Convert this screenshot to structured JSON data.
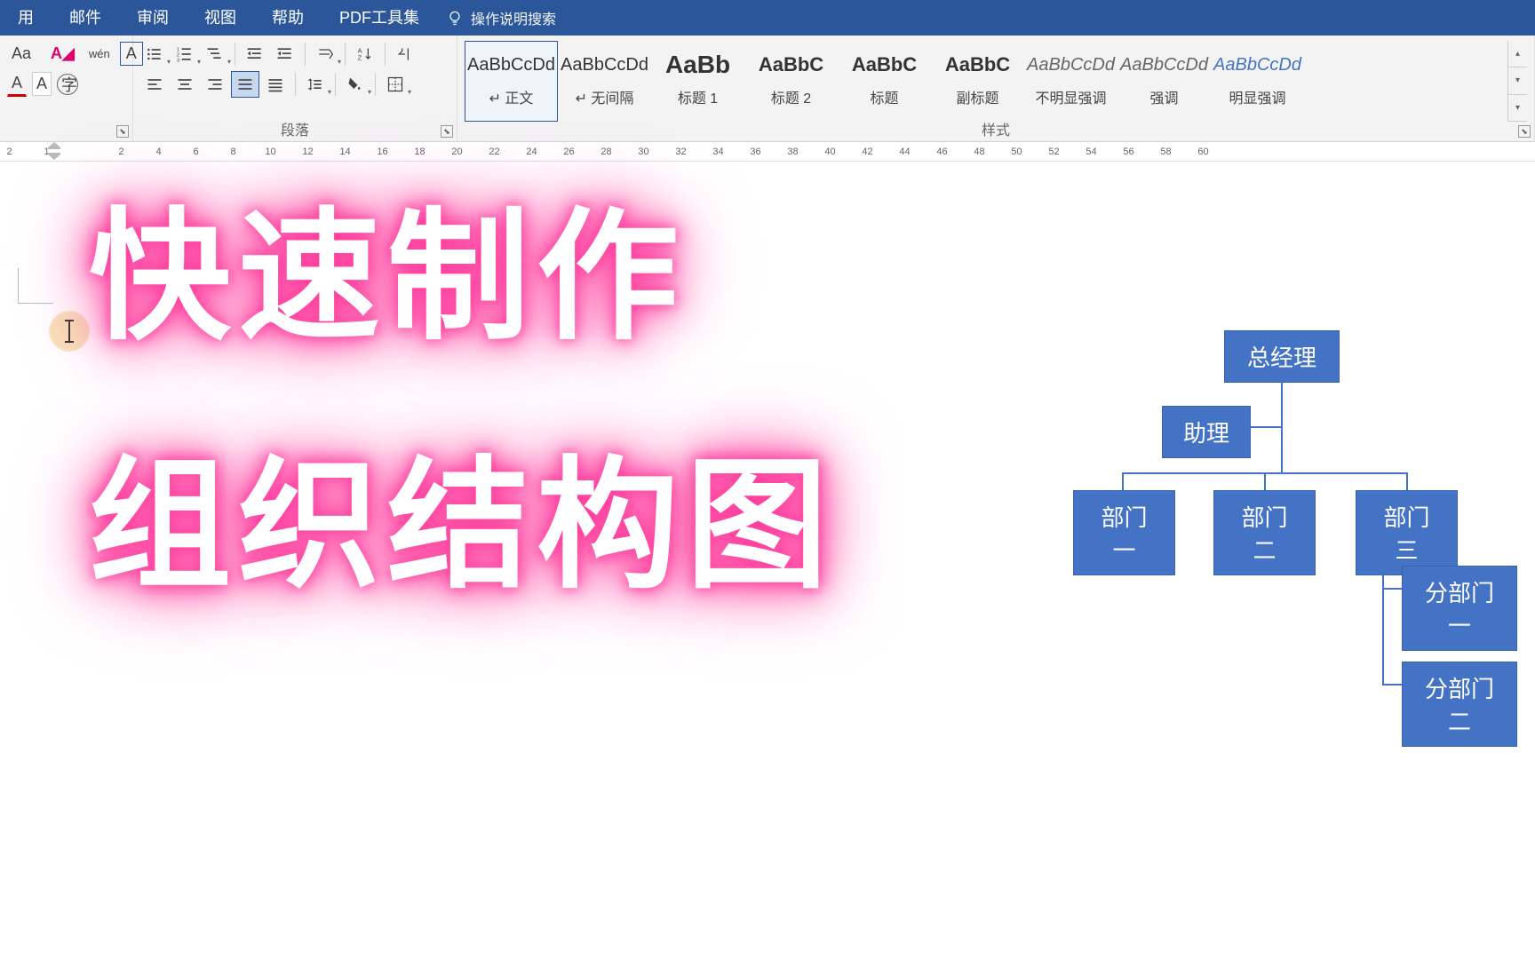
{
  "menu": {
    "tabs": [
      "用",
      "邮件",
      "审阅",
      "视图",
      "帮助",
      "PDF工具集"
    ],
    "search_placeholder": "操作说明搜索"
  },
  "ribbon": {
    "font": {
      "aa": "Aa",
      "wen": "wén",
      "char_box": "A",
      "color_a": "A",
      "circled": "字"
    },
    "paragraph": {
      "label": "段落"
    },
    "styles": {
      "label": "样式",
      "items": [
        {
          "preview": "AaBbCcDd",
          "name": "↵ 正文",
          "cls": ""
        },
        {
          "preview": "AaBbCcDd",
          "name": "↵ 无间隔",
          "cls": ""
        },
        {
          "preview": "AaBb",
          "name": "标题 1",
          "cls": "bold"
        },
        {
          "preview": "AaBbC",
          "name": "标题 2",
          "cls": "hbold"
        },
        {
          "preview": "AaBbC",
          "name": "标题",
          "cls": "hbold"
        },
        {
          "preview": "AaBbC",
          "name": "副标题",
          "cls": "hbold"
        },
        {
          "preview": "AaBbCcDd",
          "name": "不明显强调",
          "cls": "italic"
        },
        {
          "preview": "AaBbCcDd",
          "name": "强调",
          "cls": "italic"
        },
        {
          "preview": "AaBbCcDd",
          "name": "明显强调",
          "cls": "blue"
        }
      ]
    }
  },
  "ruler": {
    "marks": [
      "2",
      "",
      "1",
      "",
      "",
      "",
      "2",
      "",
      "4",
      "",
      "6",
      "",
      "8",
      "",
      "10",
      "",
      "12",
      "",
      "14",
      "",
      "16",
      "",
      "18",
      "",
      "20",
      "",
      "22",
      "",
      "24",
      "",
      "26",
      "",
      "28",
      "",
      "30",
      "",
      "32",
      "",
      "34",
      "",
      "36",
      "",
      "38",
      "",
      "40",
      "",
      "42",
      "",
      "44",
      "",
      "46",
      "",
      "48",
      "",
      "50",
      "",
      "52",
      "",
      "54",
      "",
      "56",
      "",
      "58",
      "",
      "60"
    ]
  },
  "overlay": {
    "line1": "快速制作",
    "line2": "组织结构图"
  },
  "org": {
    "top": "总经理",
    "assistant": "助理",
    "depts": [
      "部门一",
      "部门二",
      "部门三"
    ],
    "subs": [
      "分部门一",
      "分部门二"
    ]
  }
}
